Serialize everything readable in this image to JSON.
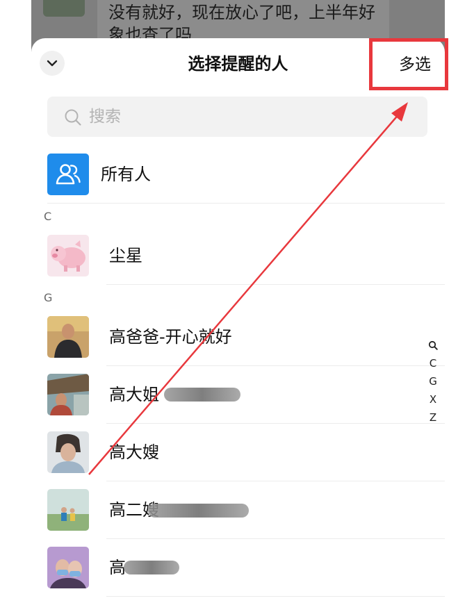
{
  "background_chat": {
    "message_text": "没有就好，现在放心了吧，上半年好象也查了吗"
  },
  "header": {
    "collapse_icon": "chevron-down-icon",
    "title": "选择提醒的人",
    "multi_select_label": "多选"
  },
  "search": {
    "icon": "search-icon",
    "placeholder": "搜索"
  },
  "all_members": {
    "icon": "group-icon",
    "label": "所有人"
  },
  "sections": [
    {
      "letter": "C",
      "contacts": [
        {
          "name": "尘星"
        }
      ]
    },
    {
      "letter": "G",
      "contacts": [
        {
          "name": "高爸爸-开心就好"
        },
        {
          "name": "高大姐"
        },
        {
          "name": "高大嫂"
        },
        {
          "name": "高二嫂"
        },
        {
          "name": "高"
        }
      ]
    }
  ],
  "index_bar": [
    "C",
    "G",
    "X",
    "Z"
  ],
  "colors": {
    "accent_blue": "#1f8ceb",
    "annotation_red": "#e8383d",
    "dim_overlay": "#7f7f7f"
  }
}
